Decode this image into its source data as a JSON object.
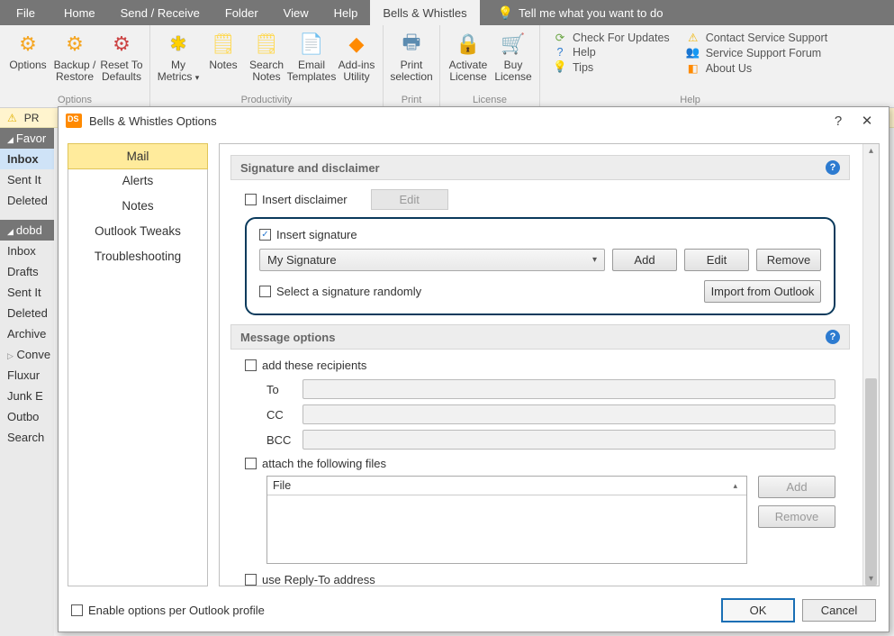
{
  "menu": {
    "file": "File",
    "home": "Home",
    "sendreceive": "Send / Receive",
    "folder": "Folder",
    "view": "View",
    "help": "Help",
    "bells": "Bells & Whistles",
    "tell": "Tell me what you want to do"
  },
  "ribbon": {
    "options": "Options",
    "backup": "Backup / Restore",
    "reset": "Reset To Defaults",
    "group_options": "Options",
    "mymetrics": "My Metrics",
    "group_prod": "Productivity",
    "notes": "Notes",
    "searchnotes": "Search Notes",
    "templates": "Email Templates",
    "addins": "Add-ins Utility",
    "printsel": "Print selection",
    "group_print": "Print",
    "activate": "Activate License",
    "buy": "Buy License",
    "group_license": "License",
    "check": "Check For Updates",
    "help": "Help",
    "tips": "Tips",
    "contact": "Contact Service Support",
    "forum": "Service Support Forum",
    "about": "About Us",
    "group_help": "Help"
  },
  "warn": {
    "text": "PR"
  },
  "sidebar": {
    "fav": "Favor",
    "items1": [
      "Inbox",
      "Sent It",
      "Deleted"
    ],
    "acct": "dobd",
    "items2": [
      "Inbox",
      "Drafts",
      "Sent It",
      "Deleted",
      "Archive",
      "Conve",
      "Fluxur",
      "Junk E",
      "Outbo",
      "Search"
    ]
  },
  "dialog": {
    "title": "Bells & Whistles Options",
    "nav": [
      "Mail",
      "Alerts",
      "Notes",
      "Outlook Tweaks",
      "Troubleshooting"
    ],
    "sec_sig": "Signature and disclaimer",
    "insert_disclaimer": "Insert disclaimer",
    "edit_btn": "Edit",
    "insert_signature": "Insert signature",
    "sig_combo": "My Signature",
    "add": "Add",
    "edit": "Edit",
    "remove": "Remove",
    "select_random": "Select a signature randomly",
    "import": "Import from Outlook",
    "sec_msg": "Message options",
    "add_recip": "add these recipients",
    "to": "To",
    "cc": "CC",
    "bcc": "BCC",
    "attach": "attach the following files",
    "file_col": "File",
    "file_add": "Add",
    "file_remove": "Remove",
    "reply_to": "use Reply-To address",
    "enable_profile": "Enable options per Outlook profile",
    "ok": "OK",
    "cancel": "Cancel"
  }
}
